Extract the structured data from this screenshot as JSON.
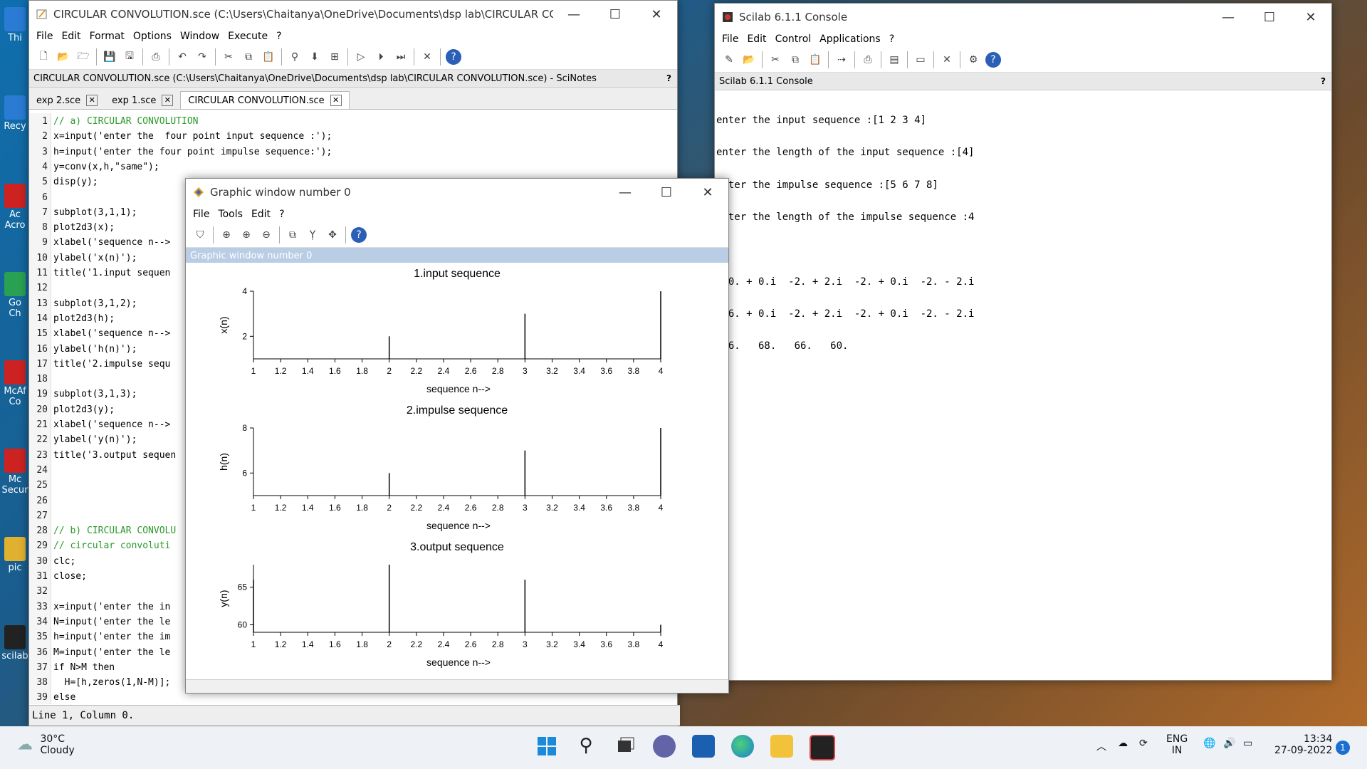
{
  "scinotes": {
    "window_title": "CIRCULAR CONVOLUTION.sce (C:\\Users\\Chaitanya\\OneDrive\\Documents\\dsp lab\\CIRCULAR CONVOLUT...",
    "menus": [
      "File",
      "Edit",
      "Format",
      "Options",
      "Window",
      "Execute",
      "?"
    ],
    "infobar": "CIRCULAR CONVOLUTION.sce (C:\\Users\\Chaitanya\\OneDrive\\Documents\\dsp lab\\CIRCULAR CONVOLUTION.sce) - SciNotes",
    "infobar_help": "?",
    "tabs": [
      {
        "label": "exp 2.sce",
        "close": "✕"
      },
      {
        "label": "exp 1.sce",
        "close": "✕"
      },
      {
        "label": "CIRCULAR CONVOLUTION.sce",
        "close": "✕"
      }
    ],
    "lines": [
      {
        "n": "1",
        "t": "// a) CIRCULAR CONVOLUTION"
      },
      {
        "n": "2",
        "t": "x=input('enter the  four point input sequence :');"
      },
      {
        "n": "3",
        "t": "h=input('enter the four point impulse sequence:');"
      },
      {
        "n": "4",
        "t": "y=conv(x,h,\"same\");"
      },
      {
        "n": "5",
        "t": "disp(y);"
      },
      {
        "n": "6",
        "t": ""
      },
      {
        "n": "7",
        "t": "subplot(3,1,1);"
      },
      {
        "n": "8",
        "t": "plot2d3(x);"
      },
      {
        "n": "9",
        "t": "xlabel('sequence n-->"
      },
      {
        "n": "10",
        "t": "ylabel('x(n)');"
      },
      {
        "n": "11",
        "t": "title('1.input sequen"
      },
      {
        "n": "12",
        "t": ""
      },
      {
        "n": "13",
        "t": "subplot(3,1,2);"
      },
      {
        "n": "14",
        "t": "plot2d3(h);"
      },
      {
        "n": "15",
        "t": "xlabel('sequence n-->"
      },
      {
        "n": "16",
        "t": "ylabel('h(n)');"
      },
      {
        "n": "17",
        "t": "title('2.impulse sequ"
      },
      {
        "n": "18",
        "t": ""
      },
      {
        "n": "19",
        "t": "subplot(3,1,3);"
      },
      {
        "n": "20",
        "t": "plot2d3(y);"
      },
      {
        "n": "21",
        "t": "xlabel('sequence n-->"
      },
      {
        "n": "22",
        "t": "ylabel('y(n)');"
      },
      {
        "n": "23",
        "t": "title('3.output sequen"
      },
      {
        "n": "24",
        "t": ""
      },
      {
        "n": "25",
        "t": ""
      },
      {
        "n": "26",
        "t": ""
      },
      {
        "n": "27",
        "t": ""
      },
      {
        "n": "28",
        "t": "// b) CIRCULAR CONVOLU"
      },
      {
        "n": "29",
        "t": "// circular convoluti"
      },
      {
        "n": "30",
        "t": "clc;"
      },
      {
        "n": "31",
        "t": "close;"
      },
      {
        "n": "32",
        "t": ""
      },
      {
        "n": "33",
        "t": "x=input('enter the in"
      },
      {
        "n": "34",
        "t": "N=input('enter the le"
      },
      {
        "n": "35",
        "t": "h=input('enter the im"
      },
      {
        "n": "36",
        "t": "M=input('enter the le"
      },
      {
        "n": "37",
        "t": "if N>M then"
      },
      {
        "n": "38",
        "t": "  H=[h,zeros(1,N-M)];"
      },
      {
        "n": "39",
        "t": "else"
      }
    ],
    "status": "Line 1, Column 0."
  },
  "console": {
    "window_title": "Scilab 6.1.1 Console",
    "menus": [
      "File",
      "Edit",
      "Control",
      "Applications",
      "?"
    ],
    "infobar": "Scilab 6.1.1 Console",
    "infobar_help": "?",
    "lines": [
      "enter the input sequence :[1 2 3 4]",
      "enter the length of the input sequence :[4]",
      "enter the impulse sequence :[5 6 7 8]",
      "enter the length of the impulse sequence :4",
      "",
      " 10. + 0.i  -2. + 2.i  -2. + 0.i  -2. - 2.i",
      " 26. + 0.i  -2. + 2.i  -2. + 0.i  -2. - 2.i",
      " 66.   68.   66.   60.",
      ">"
    ]
  },
  "gfx": {
    "window_title": "Graphic window number 0",
    "menus": [
      "File",
      "Tools",
      "Edit",
      "?"
    ],
    "label": "Graphic window number 0"
  },
  "chart_data": [
    {
      "type": "bar",
      "title": "1.input sequence",
      "xlabel": "sequence n-->",
      "ylabel": "x(n)",
      "x": [
        1,
        2,
        3,
        4
      ],
      "values": [
        1,
        2,
        3,
        4
      ],
      "xlim": [
        1,
        4
      ],
      "ylim": [
        1,
        4
      ],
      "xticks": [
        "1",
        "1.2",
        "1.4",
        "1.6",
        "1.8",
        "2",
        "2.2",
        "2.4",
        "2.6",
        "2.8",
        "3",
        "3.2",
        "3.4",
        "3.6",
        "3.8",
        "4"
      ],
      "yticks": [
        2,
        4
      ]
    },
    {
      "type": "bar",
      "title": "2.impulse sequence",
      "xlabel": "sequence n-->",
      "ylabel": "h(n)",
      "x": [
        1,
        2,
        3,
        4
      ],
      "values": [
        5,
        6,
        7,
        8
      ],
      "xlim": [
        1,
        4
      ],
      "ylim": [
        5,
        8
      ],
      "xticks": [
        "1",
        "1.2",
        "1.4",
        "1.6",
        "1.8",
        "2",
        "2.2",
        "2.4",
        "2.6",
        "2.8",
        "3",
        "3.2",
        "3.4",
        "3.6",
        "3.8",
        "4"
      ],
      "yticks": [
        6,
        8
      ]
    },
    {
      "type": "bar",
      "title": "3.output sequence",
      "xlabel": "sequence n-->",
      "ylabel": "y(n)",
      "x": [
        1,
        2,
        3,
        4
      ],
      "values": [
        66,
        68,
        66,
        60
      ],
      "xlim": [
        1,
        4
      ],
      "ylim": [
        59,
        68
      ],
      "xticks": [
        "1",
        "1.2",
        "1.4",
        "1.6",
        "1.8",
        "2",
        "2.2",
        "2.4",
        "2.6",
        "2.8",
        "3",
        "3.2",
        "3.4",
        "3.6",
        "3.8",
        "4"
      ],
      "yticks": [
        60,
        65
      ]
    }
  ],
  "desktop": {
    "icons": [
      "Thi",
      "Recy",
      "Ac Acro",
      "Go Ch",
      "McAf Co",
      "Mc Secur",
      "pic",
      "scilab"
    ]
  },
  "taskbar": {
    "temp": "30°C",
    "weather": "Cloudy",
    "lang1": "ENG",
    "lang2": "IN",
    "time": "13:34",
    "date": "27-09-2022",
    "badge": "1"
  }
}
